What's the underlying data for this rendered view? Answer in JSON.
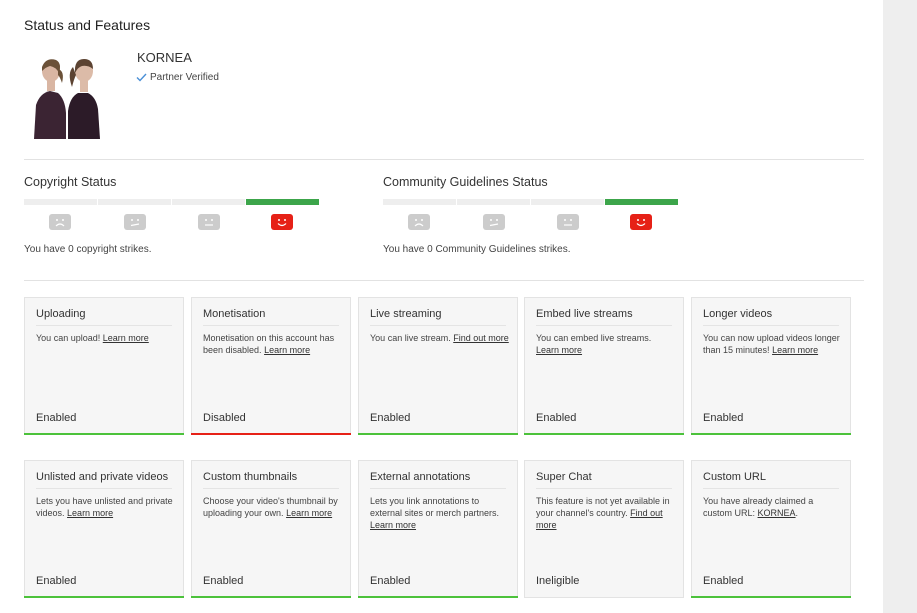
{
  "page": {
    "title": "Status and Features"
  },
  "channel": {
    "name": "KORNEA",
    "verified_label": "Partner Verified",
    "avatar_icon": "channel-avatar-two-women"
  },
  "copyright": {
    "title": "Copyright Status",
    "strike_text": "You have 0 copyright strikes.",
    "active_level": 4,
    "levels": 4
  },
  "community": {
    "title": "Community Guidelines Status",
    "strike_text": "You have 0 Community Guidelines strikes.",
    "active_level": 4,
    "levels": 4
  },
  "colors": {
    "good": "#3ca54a",
    "active_face": "#e62117",
    "enabled_bar": "#4cc23b",
    "disabled_bar": "#e62117"
  },
  "features": [
    {
      "title": "Uploading",
      "desc": "You can upload!",
      "link": "Learn more",
      "suffix": "",
      "status": "Enabled",
      "bar": "green"
    },
    {
      "title": "Monetisation",
      "desc": "Monetisation on this account has been disabled.",
      "link": "Learn more",
      "suffix": "",
      "status": "Disabled",
      "bar": "red"
    },
    {
      "title": "Live streaming",
      "desc": "You can live stream.",
      "link": "Find out more",
      "suffix": "",
      "status": "Enabled",
      "bar": "green"
    },
    {
      "title": "Embed live streams",
      "desc": "You can embed live streams.",
      "link": "Learn more",
      "suffix": "",
      "status": "Enabled",
      "bar": "green"
    },
    {
      "title": "Longer videos",
      "desc": "You can now upload videos longer than 15 minutes!",
      "link": "Learn more",
      "suffix": "",
      "status": "Enabled",
      "bar": "green"
    },
    {
      "title": "Unlisted and private videos",
      "desc": "Lets you have unlisted and private videos.",
      "link": "Learn more",
      "suffix": "",
      "status": "Enabled",
      "bar": "green"
    },
    {
      "title": "Custom thumbnails",
      "desc": "Choose your video's thumbnail by uploading your own.",
      "link": "Learn more",
      "suffix": "",
      "status": "Enabled",
      "bar": "green"
    },
    {
      "title": "External annotations",
      "desc": "Lets you link annotations to external sites or merch partners.",
      "link": "Learn more",
      "suffix": "",
      "status": "Enabled",
      "bar": "green"
    },
    {
      "title": "Super Chat",
      "desc": "This feature is not yet available in your channel's country.",
      "link": "Find out more",
      "suffix": "",
      "status": "Ineligible",
      "bar": "none"
    },
    {
      "title": "Custom URL",
      "desc": "You have already claimed a custom URL:",
      "link": "KORNEA",
      "suffix": ".",
      "status": "Enabled",
      "bar": "green"
    }
  ]
}
